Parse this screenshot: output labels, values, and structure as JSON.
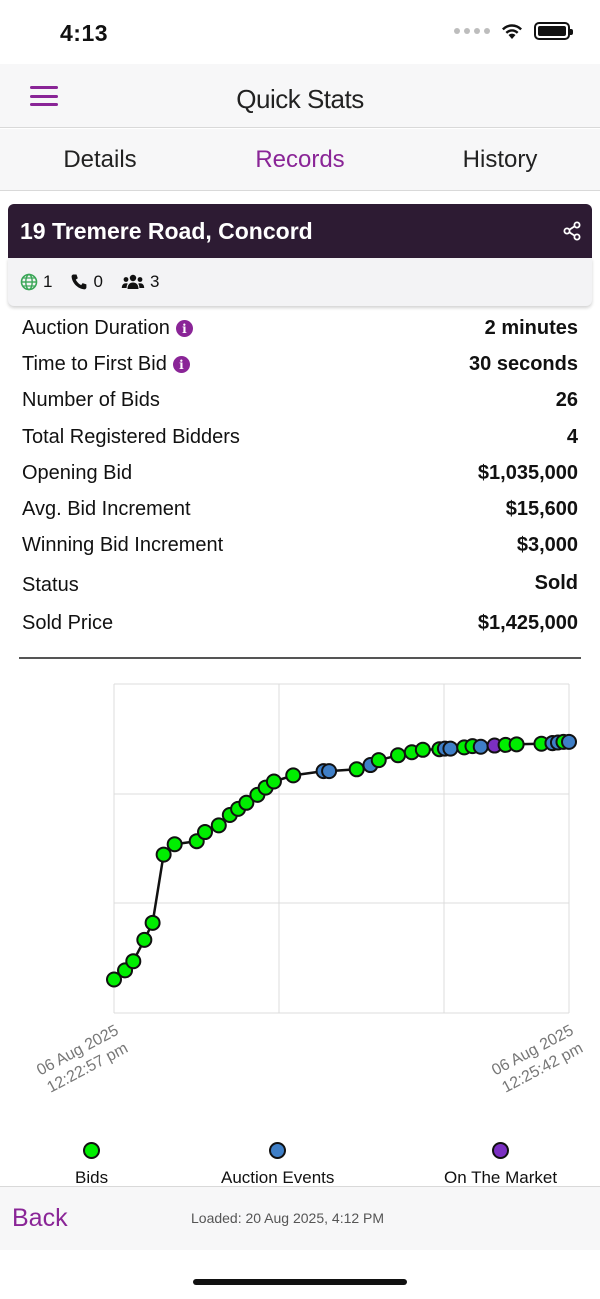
{
  "status_bar": {
    "time": "4:13"
  },
  "nav": {
    "title": "Quick Stats"
  },
  "tabs": [
    {
      "label": "Details",
      "active": false
    },
    {
      "label": "Records",
      "active": true
    },
    {
      "label": "History",
      "active": false
    }
  ],
  "card": {
    "title": "19 Tremere Road, Concord",
    "online_count": "1",
    "phone_count": "0",
    "people_count": "3"
  },
  "stats": [
    {
      "label": "Auction Duration",
      "value": "2 minutes",
      "info": true
    },
    {
      "label": "Time to First Bid",
      "value": "30 seconds",
      "info": true
    },
    {
      "label": "Number of Bids",
      "value": "26",
      "info": false
    },
    {
      "label": "Total Registered Bidders",
      "value": "4",
      "info": false
    },
    {
      "label": "Opening Bid",
      "value": "$1,035,000",
      "info": false
    },
    {
      "label": "Avg. Bid Increment",
      "value": "$15,600",
      "info": false
    },
    {
      "label": "Winning Bid Increment",
      "value": "$3,000",
      "info": false
    },
    {
      "label": "Status",
      "value": "Sold",
      "info": false
    },
    {
      "label": "Sold Price",
      "value": "$1,425,000",
      "info": false
    }
  ],
  "chart_data": {
    "type": "line",
    "x_ticks": [
      {
        "date": "06 Aug 2025",
        "time": "12:22:57 pm"
      },
      {
        "date": "06 Aug 2025",
        "time": "12:25:42 pm"
      }
    ],
    "grid": true,
    "legend_placement": "bottom",
    "series": [
      {
        "name": "Bids",
        "color": "#00ee00",
        "x_seconds": [
          0,
          4,
          7,
          11,
          14,
          18,
          22,
          30,
          33,
          38,
          42,
          45,
          48,
          52,
          55,
          58,
          65,
          88,
          96,
          103,
          108,
          112,
          118,
          127,
          130,
          142,
          146,
          155,
          159,
          163
        ],
        "values": [
          1035000,
          1050000,
          1065000,
          1100000,
          1128000,
          1240000,
          1257000,
          1262000,
          1277000,
          1288000,
          1305000,
          1315000,
          1325000,
          1338000,
          1350000,
          1360000,
          1370000,
          1380000,
          1395000,
          1403000,
          1408000,
          1412000,
          1413000,
          1416000,
          1418000,
          1420000,
          1421000,
          1422000,
          1423000,
          1425000
        ]
      },
      {
        "name": "Auction Events",
        "color": "#3f7fc7",
        "x_seconds": [
          76,
          78,
          93,
          120,
          122,
          133,
          159,
          161,
          165
        ],
        "values": [
          1377000,
          1377000,
          1387000,
          1414000,
          1414000,
          1417000,
          1423000,
          1424000,
          1425000
        ]
      },
      {
        "name": "On The Market",
        "color": "#7b2fc2",
        "x_seconds": [
          138
        ],
        "values": [
          1419000
        ]
      }
    ],
    "x_range": [
      0,
      165
    ],
    "y_range": [
      980000,
      1520000
    ]
  },
  "legend": [
    {
      "name": "Bids",
      "color": "#00ee00"
    },
    {
      "name": "Auction Events",
      "color": "#3f7fc7"
    },
    {
      "name": "On The Market",
      "color": "#7b2fc2"
    }
  ],
  "footer": {
    "back_label": "Back",
    "loaded_text": "Loaded: 20 Aug 2025, 4:12 PM"
  }
}
